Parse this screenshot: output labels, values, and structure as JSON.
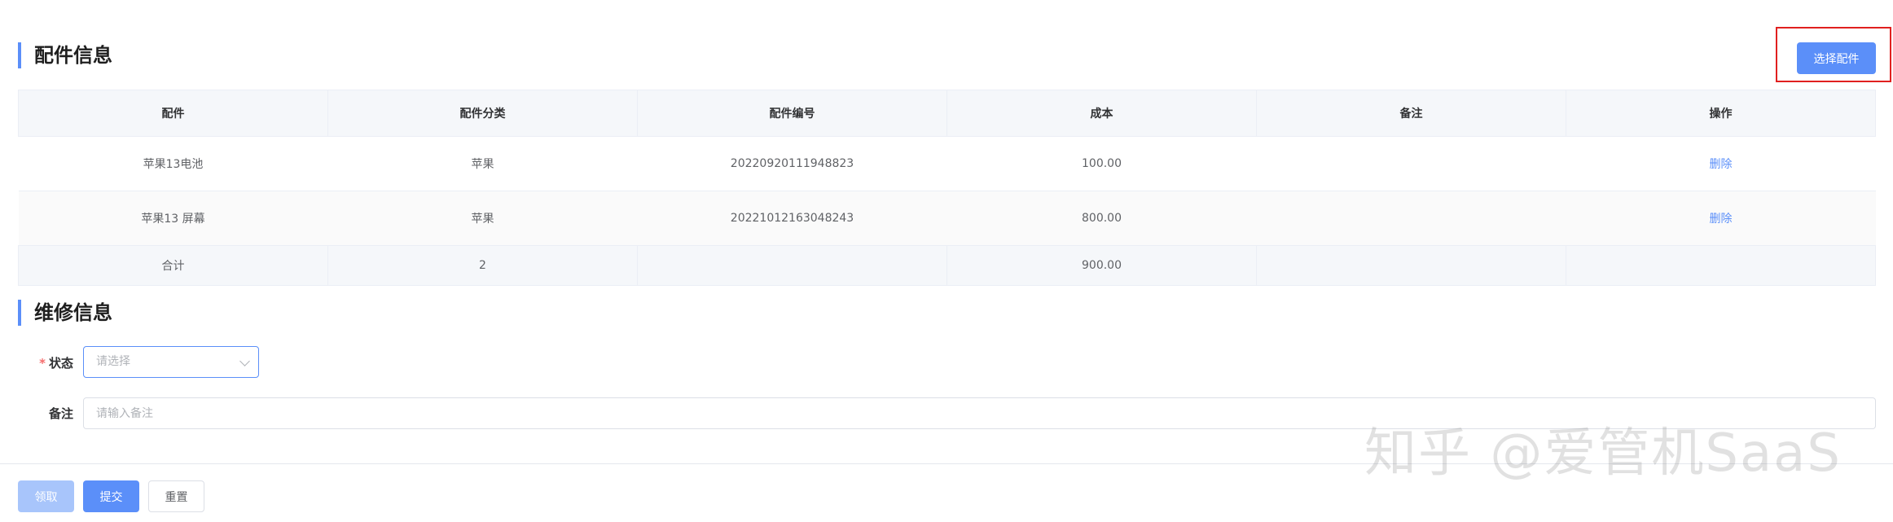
{
  "parts_section": {
    "title": "配件信息",
    "choose_button": "选择配件",
    "columns": [
      "配件",
      "配件分类",
      "配件编号",
      "成本",
      "备注",
      "操作"
    ],
    "rows": [
      {
        "name": "苹果13电池",
        "category": "苹果",
        "code": "20220920111948823",
        "cost": "100.00",
        "remark": "",
        "action": "删除"
      },
      {
        "name": "苹果13 屏幕",
        "category": "苹果",
        "code": "20221012163048243",
        "cost": "800.00",
        "remark": "",
        "action": "删除"
      }
    ],
    "summary": {
      "label": "合计",
      "count": "2",
      "cost": "900.00"
    }
  },
  "repair_section": {
    "title": "维修信息",
    "status_label": "状态",
    "status_placeholder": "请选择",
    "remark_label": "备注",
    "remark_placeholder": "请输入备注"
  },
  "footer": {
    "claim": "领取",
    "submit": "提交",
    "reset": "重置"
  },
  "watermark": "知乎 @爱管机SaaS",
  "colors": {
    "primary": "#5b8ff9",
    "primary_disabled": "#a8c5fb",
    "highlight_box": "#e0201f",
    "required_star": "#f56c6c"
  }
}
